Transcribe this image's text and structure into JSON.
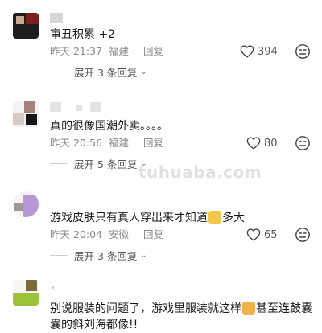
{
  "comments": [
    {
      "text": "审丑积累 +2",
      "time": "昨天 21:37",
      "location": "福建",
      "reply_label": "回复",
      "likes": "394",
      "expand_label": "展开 3 条回复"
    },
    {
      "text": "真的很像国潮外卖。。。。",
      "time": "昨天 20:56",
      "location": "福建",
      "reply_label": "回复",
      "likes": "80",
      "expand_label": "展开 5 条回复"
    },
    {
      "text_before": "游戏皮肤只有真人穿出来才知道",
      "text_after": "多大",
      "time": "昨天 20:04",
      "location": "安徽",
      "reply_label": "回复",
      "likes": "65",
      "expand_label": "展开 3 条回复"
    },
    {
      "text_line1_before": "别说服装的问题了，游戏里服装就这样",
      "text_line1_after": "甚至连鼓囊",
      "text_line2": "囊的斜刘海都像!!"
    }
  ],
  "watermark": "tuhuaba.com",
  "icons": {
    "like": "heart-outline-icon",
    "dislike": "dislike-face-icon",
    "expand": "chevron-down-icon",
    "emoji_1": "thinking-face-emoji",
    "emoji_2": "cat-face-emoji"
  },
  "colors": {
    "text": "#1a1a1a",
    "meta": "#8a8a8a",
    "expand": "#555555"
  }
}
